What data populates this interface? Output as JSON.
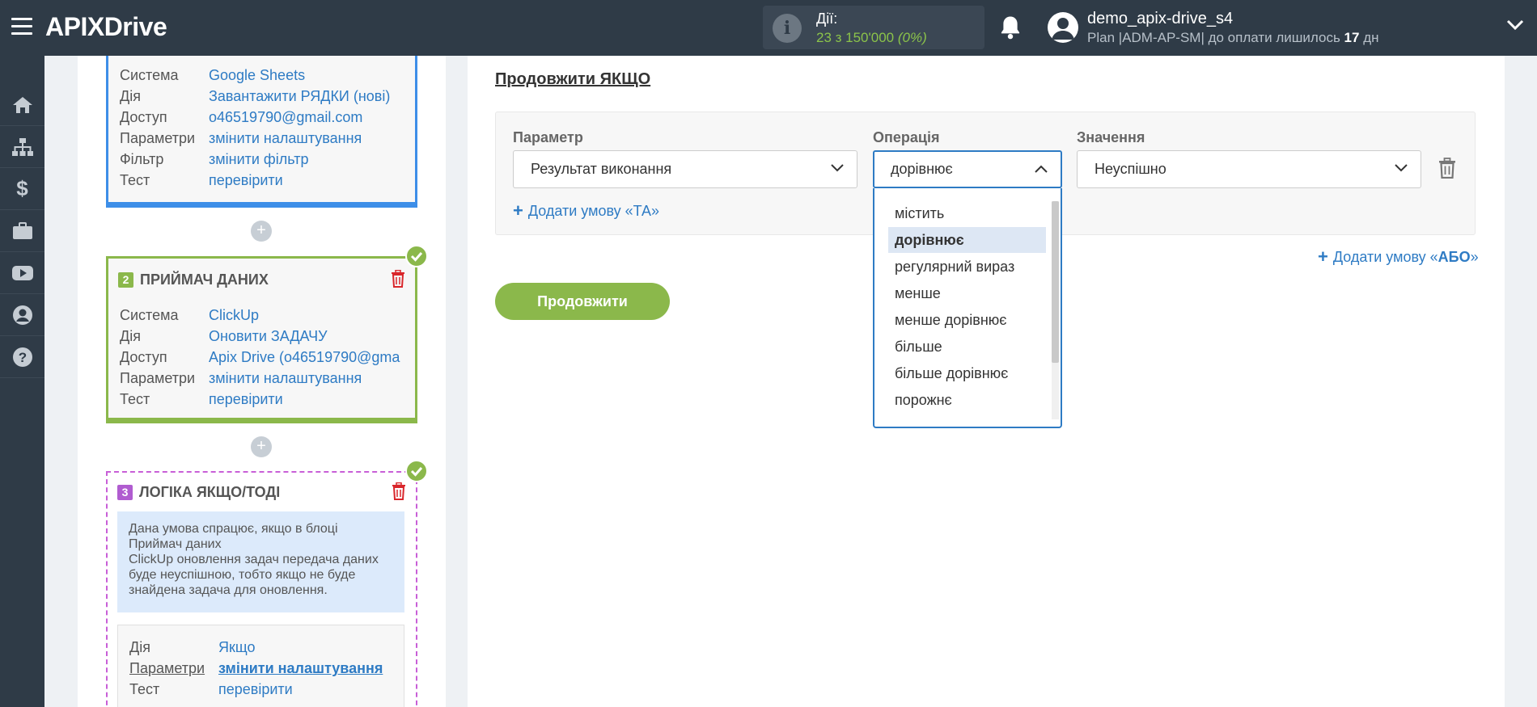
{
  "header": {
    "logo": {
      "api": "APIX",
      "x": "",
      "drive": "Drive"
    },
    "actions": {
      "label": "Дії:",
      "count": "23 з 150'000",
      "percent": "(0%)"
    },
    "user": {
      "name": "demo_apix-drive_s4",
      "plan_prefix": "Plan |ADM-AP-SM| до оплати лишилось ",
      "days": "17",
      "plan_suffix": " дн"
    }
  },
  "sidebar": {
    "items": [
      "home-icon",
      "sitemap-icon",
      "dollar-icon",
      "briefcase-icon",
      "youtube-icon",
      "user-icon",
      "help-icon"
    ]
  },
  "block1": {
    "rows": [
      {
        "label": "Система",
        "value": "Google Sheets"
      },
      {
        "label": "Дія",
        "value": "Завантажити РЯДКИ (нові)"
      },
      {
        "label": "Доступ",
        "value": "o46519790@gmail.com"
      },
      {
        "label": "Параметри",
        "value": "змінити налаштування"
      },
      {
        "label": "Фільтр",
        "value": "змінити фільтр"
      },
      {
        "label": "Тест",
        "value": "перевірити"
      }
    ]
  },
  "block2": {
    "number": "2",
    "title": "ПРИЙМАЧ ДАНИХ",
    "rows": [
      {
        "label": "Система",
        "value": "ClickUp"
      },
      {
        "label": "Дія",
        "value": "Оновити ЗАДАЧУ"
      },
      {
        "label": "Доступ",
        "value": "Apix Drive (o46519790@gma"
      },
      {
        "label": "Параметри",
        "value": "змінити налаштування"
      },
      {
        "label": "Тест",
        "value": "перевірити"
      }
    ]
  },
  "block3": {
    "number": "3",
    "title": "ЛОГІКА ЯКЩО/ТОДІ",
    "note_line1": "Дана умова спрацює, якщо в блоці",
    "note_line2": "Приймач даних",
    "note_line3": "ClickUp оновлення задач передача даних",
    "note_line4": "буде неуспішною, тобто якщо не буде",
    "note_line5": "знайдена задача для оновлення.",
    "rows": [
      {
        "label": "Дія",
        "value": "Якщо"
      },
      {
        "label": "Параметри",
        "value": "змінити налаштування"
      },
      {
        "label": "Тест",
        "value": "перевірити"
      }
    ]
  },
  "main": {
    "title": "Продовжити ЯКЩО",
    "param_label": "Параметр",
    "op_label": "Операція",
    "value_label": "Значення",
    "param_value": "Результат виконання",
    "op_value": "дорівнює",
    "value_value": "Неуспішно",
    "add_and": "Додати умову «ТА»",
    "add_or_prefix": "Додати умову «",
    "add_or_bold": "АБО",
    "add_or_suffix": "»",
    "continue": "Продовжити"
  },
  "dropdown": {
    "options": [
      "містить",
      "дорівнює",
      "регулярний вираз",
      "менше",
      "менше дорівнює",
      "більше",
      "більше дорівнює",
      "порожнє"
    ],
    "selected_index": 1
  },
  "colors": {
    "topbar": "#2f3b47",
    "link": "#2e7bc4",
    "green": "#8bb84b",
    "blue_block": "#3d8ee8",
    "purple_block": "#c85fd7",
    "red": "#d9262b"
  }
}
